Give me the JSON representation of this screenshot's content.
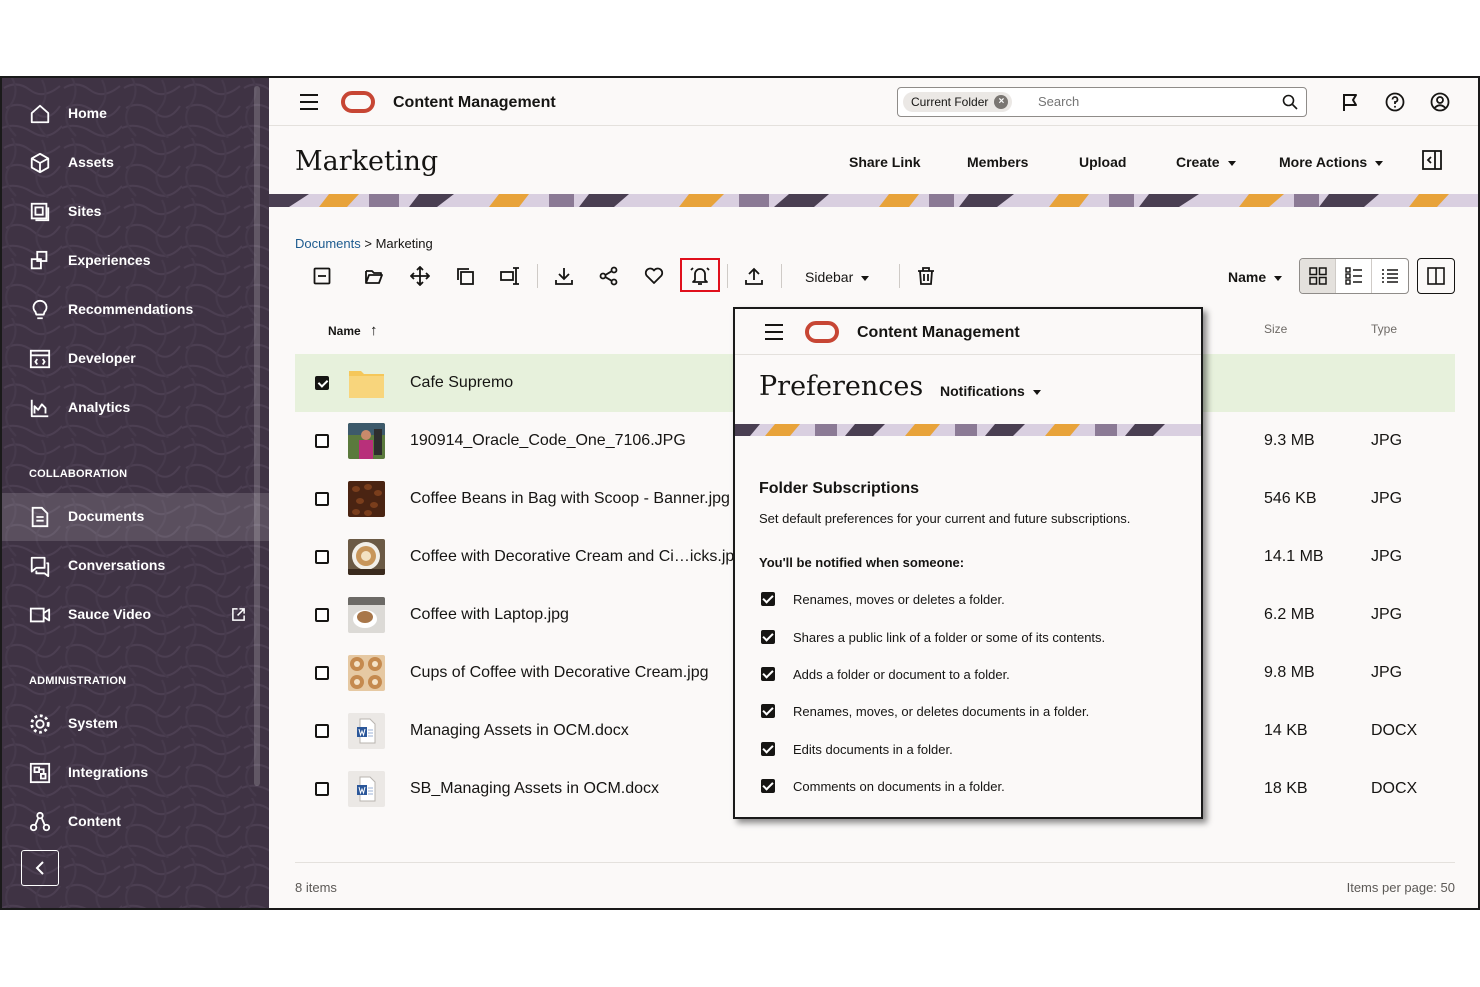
{
  "sidebar": {
    "items": [
      {
        "label": "Home",
        "icon": "home-icon"
      },
      {
        "label": "Assets",
        "icon": "cube-icon"
      },
      {
        "label": "Sites",
        "icon": "sites-icon"
      },
      {
        "label": "Experiences",
        "icon": "experiences-icon"
      },
      {
        "label": "Recommendations",
        "icon": "lightbulb-icon"
      },
      {
        "label": "Developer",
        "icon": "code-icon"
      },
      {
        "label": "Analytics",
        "icon": "analytics-icon"
      }
    ],
    "collaboration_header": "COLLABORATION",
    "collaboration_items": [
      {
        "label": "Documents",
        "icon": "documents-icon",
        "active": true
      },
      {
        "label": "Conversations",
        "icon": "conversations-icon"
      },
      {
        "label": "Sauce Video",
        "icon": "video-icon"
      }
    ],
    "administration_header": "ADMINISTRATION",
    "administration_items": [
      {
        "label": "System",
        "icon": "gear-icon"
      },
      {
        "label": "Integrations",
        "icon": "integrations-icon"
      },
      {
        "label": "Content",
        "icon": "content-icon"
      }
    ]
  },
  "header": {
    "app_title": "Content Management",
    "search_scope": "Current Folder",
    "search_placeholder": "Search"
  },
  "page": {
    "title": "Marketing",
    "actions": [
      "Share Link",
      "Members",
      "Upload",
      "Create",
      "More Actions"
    ]
  },
  "breadcrumb": {
    "root": "Documents",
    "separator": ">",
    "current": "Marketing"
  },
  "toolbar": {
    "sidebar_label": "Sidebar",
    "sort_label": "Name"
  },
  "table": {
    "columns": {
      "name": "Name",
      "size": "Size",
      "type": "Type"
    },
    "sort_arrow": "↑",
    "rows": [
      {
        "name": "Cafe Supremo",
        "size": "",
        "type": "",
        "kind": "folder",
        "selected": true
      },
      {
        "name": "190914_Oracle_Code_One_7106.JPG",
        "size": "9.3 MB",
        "type": "JPG",
        "kind": "photo-person"
      },
      {
        "name": "Coffee Beans in Bag with Scoop - Banner.jpg",
        "size": "546 KB",
        "type": "JPG",
        "kind": "photo-beans"
      },
      {
        "name": "Coffee with Decorative Cream and Ci…icks.jpg",
        "size": "14.1 MB",
        "type": "JPG",
        "kind": "photo-latte"
      },
      {
        "name": "Coffee with Laptop.jpg",
        "size": "6.2 MB",
        "type": "JPG",
        "kind": "photo-laptop"
      },
      {
        "name": "Cups of Coffee with Decorative Cream.jpg",
        "size": "9.8 MB",
        "type": "JPG",
        "kind": "photo-cups"
      },
      {
        "name": "Managing Assets in OCM.docx",
        "size": "14 KB",
        "type": "DOCX",
        "kind": "docx"
      },
      {
        "name": "SB_Managing Assets in OCM.docx",
        "size": "18 KB",
        "type": "DOCX",
        "kind": "docx"
      }
    ]
  },
  "footer": {
    "count": "8 items",
    "per_page": "Items per page: 50"
  },
  "popup": {
    "app_title": "Content Management",
    "heading": "Preferences",
    "tab": "Notifications",
    "section_title": "Folder Subscriptions",
    "section_desc": "Set default preferences for your current and future subscriptions.",
    "notify_header": "You'll be notified when someone:",
    "options": [
      "Renames, moves or deletes a folder.",
      "Shares a public link of a folder or some of its contents.",
      "Adds a folder or document to a folder.",
      "Renames, moves, or deletes documents in a folder.",
      "Edits documents in a folder.",
      "Comments on documents in a folder."
    ]
  },
  "colors": {
    "sidebar_bg": "#3f3344",
    "brand_red": "#c74634",
    "selected_row": "#e7f1dc",
    "highlight": "#e0101c",
    "link": "#1d5b8f"
  }
}
